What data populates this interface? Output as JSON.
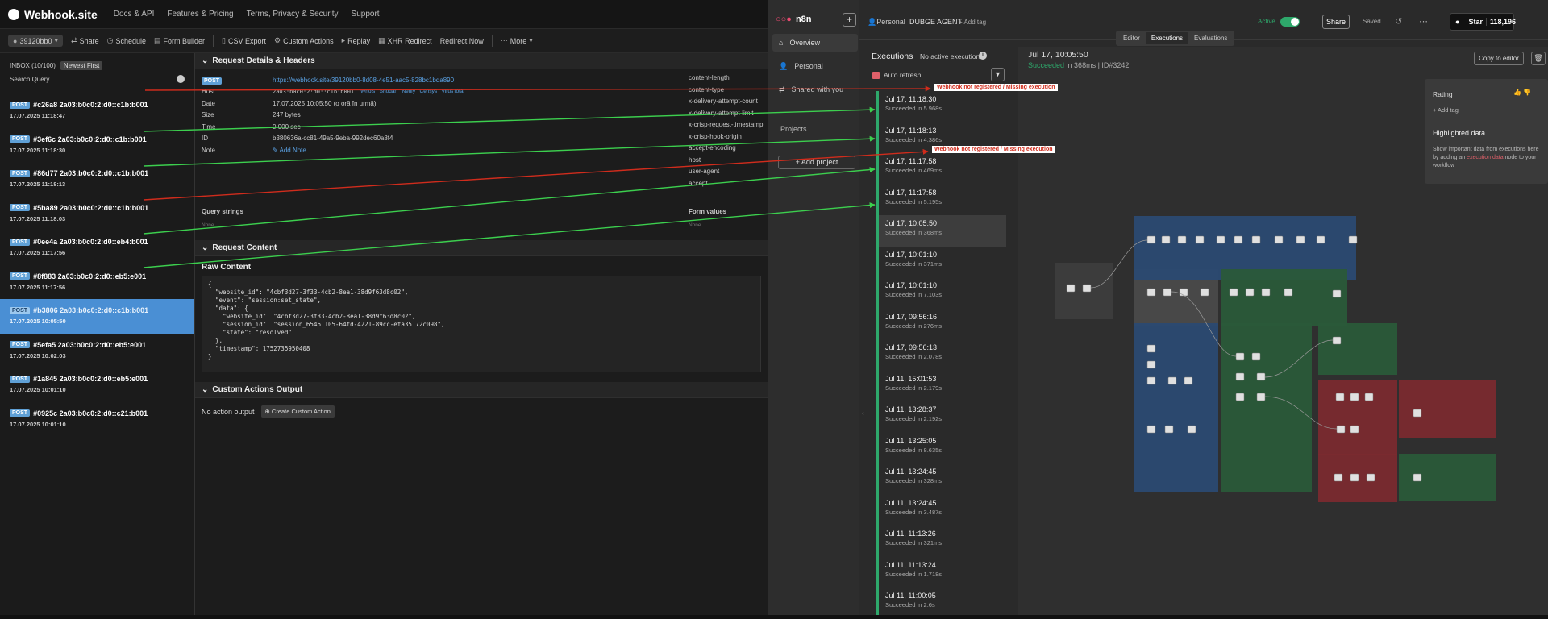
{
  "webhook": {
    "site_name": "Webhook.site",
    "nav": [
      "Docs & API",
      "Features & Pricing",
      "Terms, Privacy & Security",
      "Support"
    ],
    "toolbar": {
      "token": "39120bb0",
      "items": [
        "Share",
        "Schedule",
        "Form Builder",
        "CSV Export",
        "Custom Actions",
        "Replay",
        "XHR Redirect",
        "Redirect Now",
        "More"
      ]
    },
    "inbox_label": "INBOX (10/100)",
    "sort_label": "Newest First",
    "search_label": "Search Query",
    "help_icon_text": "?",
    "method_badge": "POST",
    "requests": [
      {
        "id": "#c26a8 2a03:b0c0:2:d0::c1b:b001",
        "time": "17.07.2025 11:18:47"
      },
      {
        "id": "#3ef6c 2a03:b0c0:2:d0::c1b:b001",
        "time": "17.07.2025 11:18:30"
      },
      {
        "id": "#86d77 2a03:b0c0:2:d0::c1b:b001",
        "time": "17.07.2025 11:18:13"
      },
      {
        "id": "#5ba89 2a03:b0c0:2:d0::c1b:b001",
        "time": "17.07.2025 11:18:03"
      },
      {
        "id": "#0ee4a 2a03:b0c0:2:d0::eb4:b001",
        "time": "17.07.2025 11:17:56"
      },
      {
        "id": "#8f883 2a03:b0c0:2:d0::eb5:e001",
        "time": "17.07.2025 11:17:56"
      },
      {
        "id": "#b3806 2a03:b0c0:2:d0::c1b:b001",
        "time": "17.07.2025 10:05:50"
      },
      {
        "id": "#5efa5 2a03:b0c0:2:d0::eb5:e001",
        "time": "17.07.2025 10:02:03"
      },
      {
        "id": "#1a845 2a03:b0c0:2:d0::eb5:e001",
        "time": "17.07.2025 10:01:10"
      },
      {
        "id": "#0925c 2a03:b0c0:2:d0::c21:b001",
        "time": "17.07.2025 10:01:10"
      }
    ],
    "details": {
      "section_title": "Request Details & Headers",
      "url": "https://webhook.site/39120bb0-8d08-4e51-aac5-828bc1bda890",
      "host_label": "Host",
      "host_value": "2a03:b0c0:2:d0::c1b:b001",
      "host_links": "Whois   Shodan   Netify   Censys   VirusTotal",
      "date_label": "Date",
      "date_value": "17.07.2025 10:05:50 (o oră în urmă)",
      "size_label": "Size",
      "size_value": "247 bytes",
      "time_label": "Time",
      "time_value": "0.000 sec",
      "id_label": "ID",
      "id_value": "b380636a-cc81-49a5-9eba-992dec60a8f4",
      "note_label": "Note",
      "note_link": "Add Note",
      "headers": [
        "content-length",
        "content-type",
        "x-delivery-attempt-count",
        "x-delivery-attempt-limit",
        "x-crisp-request-timestamp",
        "x-crisp-hook-origin",
        "accept-encoding",
        "host",
        "user-agent",
        "accept"
      ],
      "query_strings": "Query strings",
      "form_values": "Form values",
      "none": "None"
    },
    "content": {
      "section_title": "Request Content",
      "raw_title": "Raw Content",
      "raw": "{\n  \"website_id\": \"4cbf3d27-3f33-4cb2-8ea1-38d9f63d8c02\",\n  \"event\": \"session:set_state\",\n  \"data\": {\n    \"website_id\": \"4cbf3d27-3f33-4cb2-8ea1-38d9f63d8c02\",\n    \"session_id\": \"session_65461105-64fd-4221-89cc-efa35172c098\",\n    \"state\": \"resolved\"\n  },\n  \"timestamp\": 1752735950408\n}"
    },
    "custom_actions": {
      "section_title": "Custom Actions Output",
      "no_action": "No action output",
      "create_button": "Create Custom Action"
    }
  },
  "n8n": {
    "logo": "n8n",
    "nav": [
      "Overview",
      "Personal",
      "Shared with you"
    ],
    "projects_label": "Projects",
    "add_project": "Add project",
    "breadcrumb_owner": "Personal",
    "workflow_name": "DUBGE AGENT",
    "add_tag": "+ Add tag",
    "active_label": "Active",
    "share_button": "Share",
    "saved_label": "Saved",
    "star_label": "Star",
    "star_count": "118,196",
    "tabs": [
      "Editor",
      "Executions",
      "Evaluations"
    ],
    "executions_title": "Executions",
    "no_active": "No active executions",
    "auto_refresh": "Auto refresh",
    "executions": [
      {
        "time": "Jul 17, 11:18:30",
        "status": "Succeeded in 5.968s"
      },
      {
        "time": "Jul 17, 11:18:13",
        "status": "Succeeded in 4.386s"
      },
      {
        "time": "Jul 17, 11:17:58",
        "status": "Succeeded in 469ms"
      },
      {
        "time": "Jul 17, 11:17:58",
        "status": "Succeeded in 5.195s"
      },
      {
        "time": "Jul 17, 10:05:50",
        "status": "Succeeded in 368ms"
      },
      {
        "time": "Jul 17, 10:01:10",
        "status": "Succeeded in 371ms"
      },
      {
        "time": "Jul 17, 10:01:10",
        "status": "Succeeded in 7.103s"
      },
      {
        "time": "Jul 17, 09:56:16",
        "status": "Succeeded in 276ms"
      },
      {
        "time": "Jul 17, 09:56:13",
        "status": "Succeeded in 2.078s"
      },
      {
        "time": "Jul 11, 15:01:53",
        "status": "Succeeded in 2.179s"
      },
      {
        "time": "Jul 11, 13:28:37",
        "status": "Succeeded in 2.192s"
      },
      {
        "time": "Jul 11, 13:25:05",
        "status": "Succeeded in 8.635s"
      },
      {
        "time": "Jul 11, 13:24:45",
        "status": "Succeeded in 328ms"
      },
      {
        "time": "Jul 11, 13:24:45",
        "status": "Succeeded in 3.487s"
      },
      {
        "time": "Jul 11, 11:13:26",
        "status": "Succeeded in 321ms"
      },
      {
        "time": "Jul 11, 11:13:24",
        "status": "Succeeded in 1.718s"
      },
      {
        "time": "Jul 11, 11:00:05",
        "status": "Succeeded in 2.6s"
      }
    ],
    "detail": {
      "time": "Jul 17, 10:05:50",
      "status_word": "Succeeded",
      "status_rest": " in 368ms | ID#3242",
      "copy_button": "Copy to editor"
    },
    "side_card": {
      "rating": "Rating",
      "add_tag": "+ Add tag",
      "highlighted": "Highlighted data",
      "desc_before": "Show important data from executions here by adding an ",
      "desc_link": "execution data",
      "desc_after": " node to your workflow"
    }
  },
  "annotations": {
    "missing_label": "Webhook not registered / Missing execution"
  },
  "colors": {
    "webhook_selected": "#4a8fd4",
    "n8n_success": "#2ea86b",
    "annotation_red": "#d02c1c",
    "annotation_green": "#3ccf4e"
  }
}
